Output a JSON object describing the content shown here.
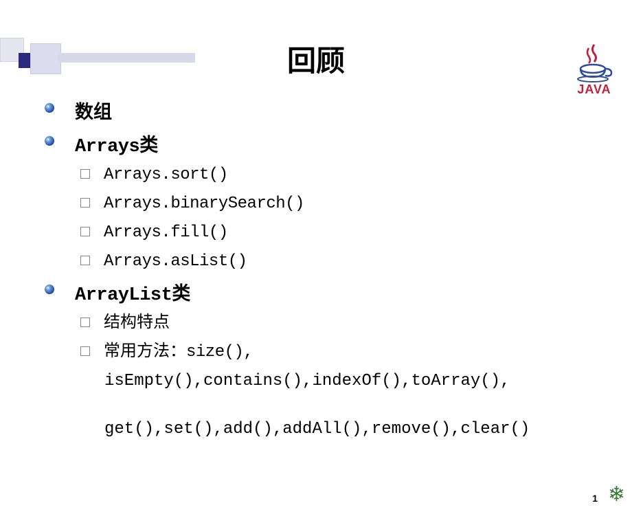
{
  "logo": {
    "text": "JAVA"
  },
  "title": "回顾",
  "items": [
    {
      "type": "l1",
      "text": "数组"
    },
    {
      "type": "l1",
      "text": "Arrays类",
      "mono_prefix": "Arrays"
    },
    {
      "type": "l2",
      "text": "Arrays.sort()",
      "mono": true
    },
    {
      "type": "l2",
      "text": "Arrays.binarySearch()",
      "mono": true
    },
    {
      "type": "l2",
      "text": "Arrays.fill()",
      "mono": true
    },
    {
      "type": "l2",
      "text": "Arrays.asList()",
      "mono": true
    },
    {
      "type": "l1",
      "text": "ArrayList类",
      "mono_prefix": "ArrayList"
    },
    {
      "type": "l2",
      "text": "结构特点"
    },
    {
      "type": "l2",
      "text": "常用方法：size(),"
    },
    {
      "type": "cont",
      "text": "isEmpty(),contains(),indexOf(),toArray(),"
    },
    {
      "type": "cont-gap",
      "text": "get(),set(),add(),addAll(),remove(),clear()"
    }
  ],
  "pageNumber": "1"
}
